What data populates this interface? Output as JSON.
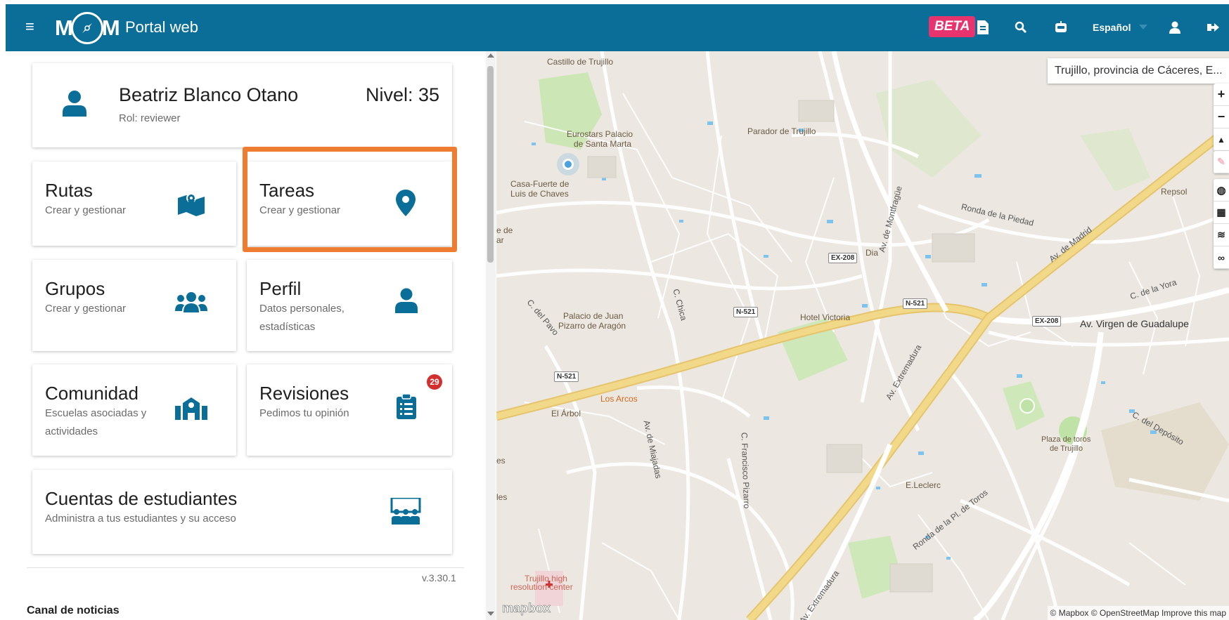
{
  "header": {
    "logo_m1": "M",
    "logo_m2": "M",
    "app_title": "Portal web",
    "beta": "BETA",
    "language": "Español"
  },
  "user": {
    "name": "Beatriz Blanco Otano",
    "role": "Rol: reviewer",
    "level": "Nivel: 35"
  },
  "cards": {
    "rutas": {
      "title": "Rutas",
      "subtitle": "Crear y gestionar"
    },
    "tareas": {
      "title": "Tareas",
      "subtitle": "Crear y gestionar"
    },
    "grupos": {
      "title": "Grupos",
      "subtitle": "Crear y gestionar"
    },
    "perfil": {
      "title": "Perfil",
      "subtitle_1": "Datos personales,",
      "subtitle_2": "estadísticas"
    },
    "comunidad": {
      "title": "Comunidad",
      "subtitle_1": "Escuelas asociadas y",
      "subtitle_2": "actividades"
    },
    "revisiones": {
      "title": "Revisiones",
      "subtitle": "Pedimos tu opinión",
      "badge": "29"
    },
    "cuentas": {
      "title": "Cuentas de estudiantes",
      "subtitle": "Administra a tus estudiantes y su acceso"
    }
  },
  "footer": {
    "version": "v.3.30.1",
    "news_title": "Canal de noticias"
  },
  "map": {
    "search_value": "Trujillo, provincia de Cáceres, E...",
    "zoom_in": "+",
    "zoom_out": "−",
    "attribution": "© Mapbox © OpenStreetMap  Improve this map",
    "mapbox_logo": "mapbox",
    "labels": {
      "castillo": "Castillo de Trujillo",
      "eurostars_1": "Eurostars Palacio",
      "eurostars_2": "de Santa Marta",
      "parador": "Parador de Trujillo",
      "casa_fuerte_1": "Casa-Fuerte de",
      "casa_fuerte_2": "Luis de Chaves",
      "ronda_piedad": "Ronda de la Piedad",
      "av_montfrague": "Av. de Montfragüe",
      "dia": "Dia",
      "av_madrid": "Av. de Madrid",
      "repsol": "Repsol",
      "c_yora": "C. de la Yora",
      "av_virgen": "Av. Virgen de Guadalupe",
      "c_pavo": "C. del Pavo",
      "palacio_1": "Palacio de Juan",
      "palacio_2": "Pizarro de Aragón",
      "c_chica": "C. Chica",
      "hotel_victoria": "Hotel Victoria",
      "av_extremadura_1": "Av. Extremadura",
      "c_deposito": "C. del Depósito",
      "plaza_toros_1": "Plaza de toros",
      "plaza_toros_2": "de Trujillo",
      "los_arcos": "Los Arcos",
      "el_arbol": "El Árbol",
      "av_miajadas": "Av. de Miajadas",
      "c_francisco": "C. Francisco Pizarro",
      "eleclerc": "E.Leclerc",
      "ronda_toros": "Ronda de la Pl. de Toros",
      "av_extremadura_2": "Av. Extremadura",
      "trujillo_high_1": "Trujillo high",
      "trujillo_high_2": "resolution center",
      "edge_de": "e de",
      "edge_ar": "ar",
      "edge_es": "es",
      "edge_les": "les",
      "shield_ex208_a": "EX-208",
      "shield_ex208_b": "EX-208",
      "shield_n521_a": "N-521",
      "shield_n521_b": "N-521",
      "shield_n521_c": "N-521"
    }
  }
}
